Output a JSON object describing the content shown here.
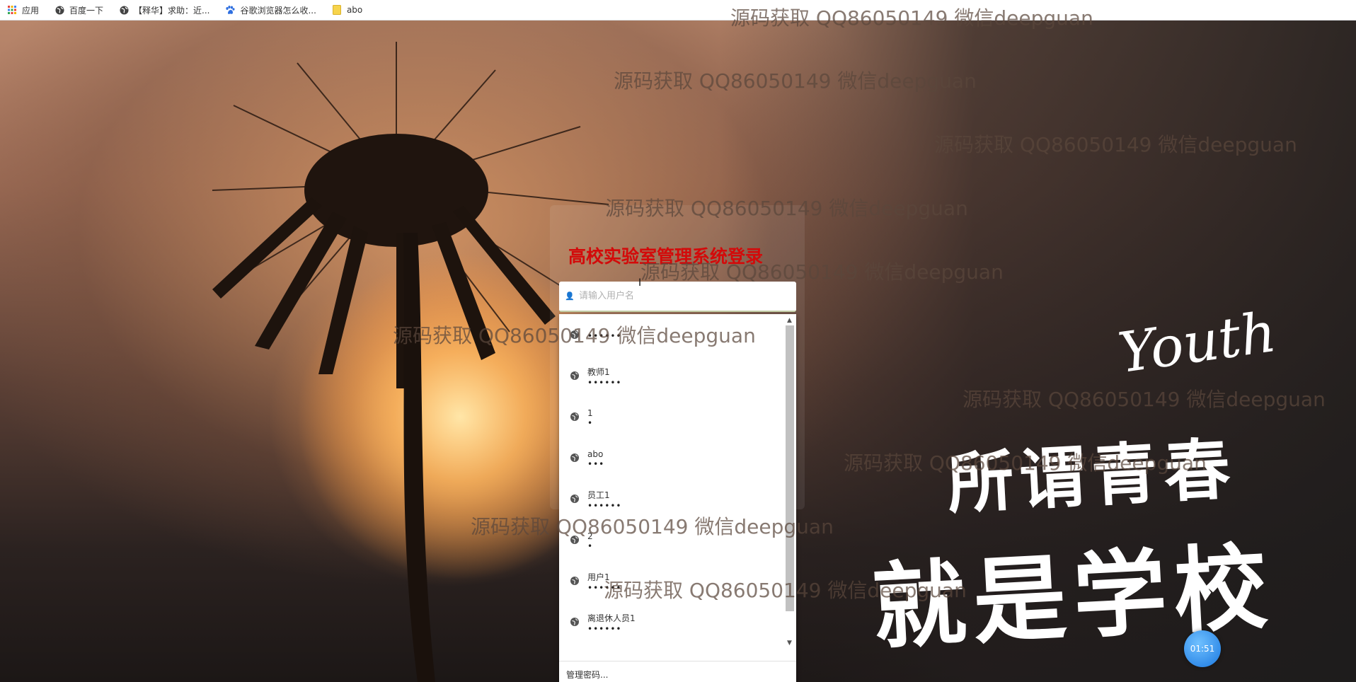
{
  "bookmarks": [
    {
      "icon": "apps-grid-icon",
      "label": "应用"
    },
    {
      "icon": "globe-icon",
      "label": "百度一下"
    },
    {
      "icon": "globe-icon",
      "label": "【释华】求助：近..."
    },
    {
      "icon": "baidu-paw-icon",
      "label": "谷歌浏览器怎么收..."
    },
    {
      "icon": "folder-icon",
      "label": "abo"
    }
  ],
  "login": {
    "title": "高校实验室管理系统登录",
    "username_placeholder": "请输入用户名"
  },
  "autofill": {
    "items": [
      {
        "name": "",
        "password": "••••••"
      },
      {
        "name": "教师1",
        "password": "••••••"
      },
      {
        "name": "1",
        "password": "•"
      },
      {
        "name": "abo",
        "password": "•••"
      },
      {
        "name": "员工1",
        "password": "••••••"
      },
      {
        "name": "2",
        "password": "•"
      },
      {
        "name": "用户1",
        "password": "••••••"
      },
      {
        "name": "离退休人员1",
        "password": "••••••"
      }
    ],
    "footer": "管理密码..."
  },
  "poster": {
    "youth": "Youth",
    "line1": "所谓青春",
    "line2": "就是学校"
  },
  "timer": "01:51",
  "watermark": "源码获取 QQ86050149 微信deepguan",
  "colors": {
    "title": "#d30a0a",
    "timer": "#1b78e0"
  }
}
